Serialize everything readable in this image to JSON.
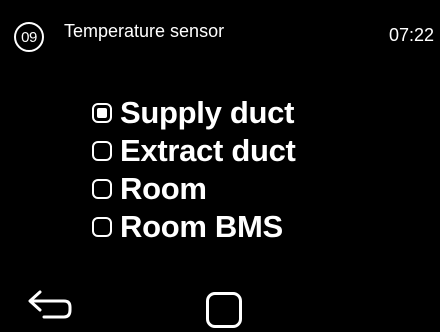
{
  "header": {
    "menu_number": "09",
    "title": "Temperature sensor",
    "time": "07:22"
  },
  "options": [
    {
      "label": "Supply duct",
      "selected": true
    },
    {
      "label": "Extract duct",
      "selected": false
    },
    {
      "label": "Room",
      "selected": false
    },
    {
      "label": "Room BMS",
      "selected": false
    }
  ],
  "footer": {
    "back_icon": "back-arrow-icon",
    "confirm_icon": "confirm-square-icon"
  },
  "colors": {
    "background": "#000000",
    "foreground": "#ffffff"
  }
}
